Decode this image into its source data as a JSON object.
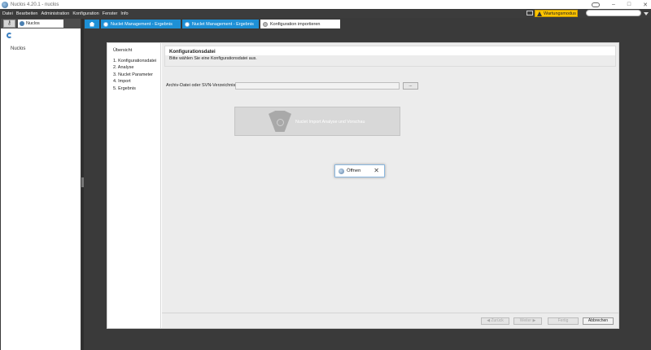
{
  "window": {
    "title": "Nuclos 4.20.1 - nuclos",
    "controls": {
      "minimize": "–",
      "maximize": "□",
      "close": "✕"
    }
  },
  "menubar": {
    "items": [
      "Datei",
      "Bearbeiten",
      "Administration",
      "Konfiguration",
      "Fenster",
      "Info"
    ]
  },
  "status": {
    "maintenance_label": "Wartungsmodus",
    "maintenance_color": "#ffc400"
  },
  "left_panel": {
    "tab_label": "Nuclos",
    "tree_root": "Nuclos"
  },
  "tabs": [
    {
      "label": "Nuclet Management - Ergebnis",
      "active": false
    },
    {
      "label": "Nuclet Management - Ergebnis",
      "active": false
    },
    {
      "label": "Konfiguration importieren",
      "active": true
    }
  ],
  "wizard": {
    "nav": {
      "heading": "Übersicht",
      "steps": [
        "1. Konfigurationsdatei",
        "2. Analyse",
        "3. Nuclet Parameter",
        "4. Import",
        "5. Ergebnis"
      ]
    },
    "header": {
      "title": "Konfigurationsdatei",
      "subtitle": "Bitte wählen Sie eine Konfigurationsdatei aus."
    },
    "file_field": {
      "label": "Archiv-Datei oder SVN-Verzeichnis",
      "value": "",
      "browse_label": "..."
    },
    "preview_button": {
      "label": "Nuclet Import Analyse und Vorschau"
    },
    "footer": {
      "back_label": "◀ Zurück",
      "next_label": "Weiter ▶",
      "finish_label": "Fertig",
      "cancel_label": "Abbrechen"
    }
  },
  "dialog": {
    "title": "Öffnen",
    "close": "✕"
  },
  "colors": {
    "accent_blue": "#1e90d6",
    "frame_dark": "#3a3a3a",
    "menubar": "#3c3c3c"
  }
}
